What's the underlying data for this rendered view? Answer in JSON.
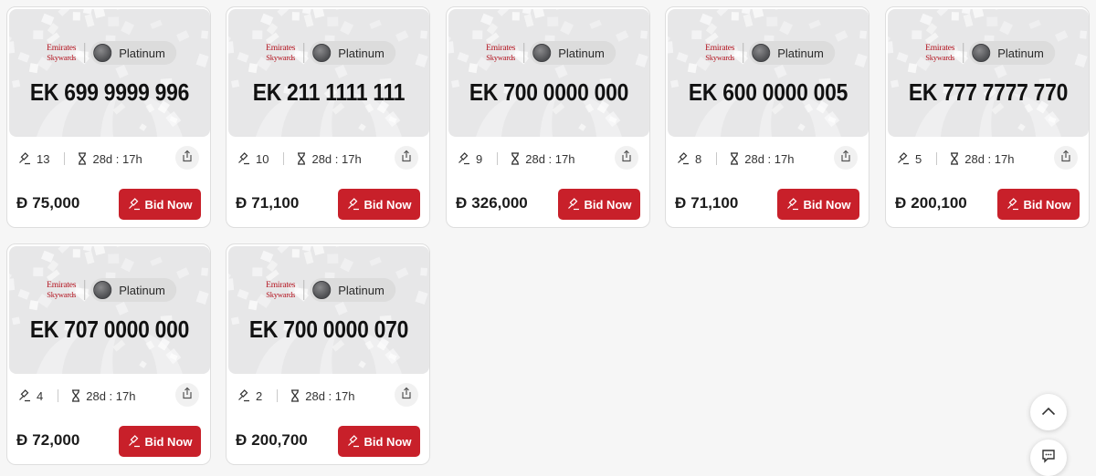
{
  "cards": [
    {
      "brand_line1": "Emirates",
      "brand_line2": "Skywards",
      "tier": "Platinum",
      "number": "EK 699 9999 996",
      "bids": "13",
      "time_left": "28d : 17h",
      "currency": "Đ",
      "price": "75,000",
      "bid_label": "Bid Now"
    },
    {
      "brand_line1": "Emirates",
      "brand_line2": "Skywards",
      "tier": "Platinum",
      "number": "EK 211 1111 111",
      "bids": "10",
      "time_left": "28d : 17h",
      "currency": "Đ",
      "price": "71,100",
      "bid_label": "Bid Now"
    },
    {
      "brand_line1": "Emirates",
      "brand_line2": "Skywards",
      "tier": "Platinum",
      "number": "EK 700 0000 000",
      "bids": "9",
      "time_left": "28d : 17h",
      "currency": "Đ",
      "price": "326,000",
      "bid_label": "Bid Now"
    },
    {
      "brand_line1": "Emirates",
      "brand_line2": "Skywards",
      "tier": "Platinum",
      "number": "EK 600 0000 005",
      "bids": "8",
      "time_left": "28d : 17h",
      "currency": "Đ",
      "price": "71,100",
      "bid_label": "Bid Now"
    },
    {
      "brand_line1": "Emirates",
      "brand_line2": "Skywards",
      "tier": "Platinum",
      "number": "EK 777 7777 770",
      "bids": "5",
      "time_left": "28d : 17h",
      "currency": "Đ",
      "price": "200,100",
      "bid_label": "Bid Now"
    },
    {
      "brand_line1": "Emirates",
      "brand_line2": "Skywards",
      "tier": "Platinum",
      "number": "EK 707 0000 000",
      "bids": "4",
      "time_left": "28d : 17h",
      "currency": "Đ",
      "price": "72,000",
      "bid_label": "Bid Now"
    },
    {
      "brand_line1": "Emirates",
      "brand_line2": "Skywards",
      "tier": "Platinum",
      "number": "EK 700 0000 070",
      "bids": "2",
      "time_left": "28d : 17h",
      "currency": "Đ",
      "price": "200,700",
      "bid_label": "Bid Now"
    }
  ],
  "icons": {
    "bid": "gavel-icon",
    "time": "hourglass-icon",
    "share": "share-icon",
    "scroll_top": "chevron-up-icon",
    "chat": "chat-icon"
  },
  "colors": {
    "accent": "#c8202a",
    "brand_red": "#b3121e",
    "hero_bg": "#e7e7e8"
  }
}
